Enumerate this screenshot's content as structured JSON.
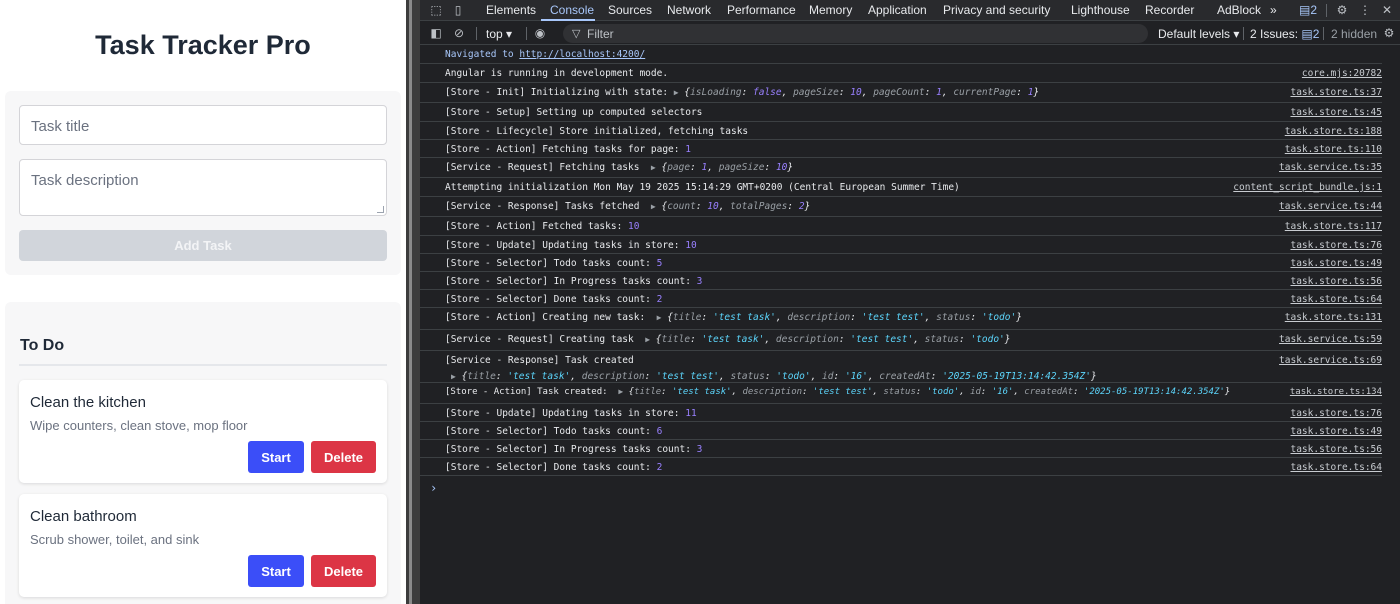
{
  "app": {
    "title": "Task Tracker Pro",
    "form": {
      "title_placeholder": "Task title",
      "description_placeholder": "Task description",
      "add_button": "Add Task"
    },
    "column": {
      "title": "To Do",
      "tasks": [
        {
          "title": "Clean the kitchen",
          "description": "Wipe counters, clean stove, mop floor",
          "start_label": "Start",
          "delete_label": "Delete"
        },
        {
          "title": "Clean bathroom",
          "description": "Scrub shower, toilet, and sink",
          "start_label": "Start",
          "delete_label": "Delete"
        }
      ]
    }
  },
  "devtools": {
    "tabs": [
      "Elements",
      "Console",
      "Sources",
      "Network",
      "Performance",
      "Memory",
      "Application",
      "Privacy and security",
      "Lighthouse",
      "Recorder",
      "AdBlock"
    ],
    "active_tab": "Console",
    "more_tabs": "»",
    "issues_badge": "2",
    "toolbar": {
      "context": "top ▾",
      "filter_placeholder": "Filter",
      "levels": "Default levels ▾",
      "issues_label": "2 Issues:",
      "issues_count": "2",
      "hidden": "2 hidden"
    },
    "console": {
      "navigated_text": "Navigated to ",
      "navigated_url": "http://localhost:4200/",
      "angular_text": "Angular is running in development mode.",
      "angular_src": "core.mjs:20782",
      "init_prefix": "[Store - Init] Initializing with state: ",
      "init_src": "task.store.ts:37",
      "setup_text": "[Store - Setup] Setting up computed selectors",
      "setup_src": "task.store.ts:45",
      "lifecycle_text": "[Store - Lifecycle] Store initialized, fetching tasks",
      "lifecycle_src": "task.store.ts:188",
      "fetching_prefix": "[Store - Action] Fetching tasks for page: ",
      "fetching_page": "1",
      "fetching_src": "task.store.ts:110",
      "svc_req_prefix": "[Service - Request] Fetching tasks  ",
      "svc_req_src": "task.service.ts:35",
      "attempt_text": "Attempting initialization Mon May 19 2025 15:14:29 GMT+0200 (Central European Summer Time)",
      "attempt_src": "content_script_bundle.js:1",
      "svc_resp_prefix": "[Service - Response] Tasks fetched  ",
      "svc_resp_src": "task.service.ts:44",
      "fetched_prefix": "[Store - Action] Fetched tasks: ",
      "fetched_count": "10",
      "fetched_src": "task.store.ts:117",
      "update1_prefix": "[Store - Update] Updating tasks in store: ",
      "update1_count": "10",
      "update1_src": "task.store.ts:76",
      "todo1_prefix": "[Store - Selector] Todo tasks count: ",
      "todo1_count": "5",
      "todo1_src": "task.store.ts:49",
      "inprog1_prefix": "[Store - Selector] In Progress tasks count: ",
      "inprog1_count": "3",
      "inprog1_src": "task.store.ts:56",
      "done1_prefix": "[Store - Selector] Done tasks count: ",
      "done1_count": "2",
      "done1_src": "task.store.ts:64",
      "create_action_prefix": "[Store - Action] Creating new task:  ",
      "create_action_src": "task.store.ts:131",
      "create_req_prefix": "[Service - Request] Creating task  ",
      "create_req_src": "task.service.ts:59",
      "created_resp_text": "[Service - Response] Task created",
      "created_resp_src": "task.service.ts:69",
      "task_created_prefix": "[Store - Action] Task created:  ",
      "task_created_src": "task.store.ts:134",
      "update2_prefix": "[Store - Update] Updating tasks in store: ",
      "update2_count": "11",
      "update2_src": "task.store.ts:76",
      "todo2_prefix": "[Store - Selector] Todo tasks count: ",
      "todo2_count": "6",
      "todo2_src": "task.store.ts:49",
      "inprog2_prefix": "[Store - Selector] In Progress tasks count: ",
      "inprog2_count": "3",
      "inprog2_src": "task.store.ts:56",
      "done2_prefix": "[Store - Selector] Done tasks count: ",
      "done2_count": "2",
      "done2_src": "task.store.ts:64",
      "prompt": "›"
    },
    "objects": {
      "init_obj": {
        "isLoading": "false",
        "pageSize": "10",
        "pageCount": "1",
        "currentPage": "1"
      },
      "svc_req_obj": {
        "page": "1",
        "pageSize": "10"
      },
      "svc_resp_obj": {
        "count": "10",
        "totalPages": "2"
      },
      "new_task": {
        "title": "'test task'",
        "description": "'test test'",
        "status": "'todo'"
      },
      "created_task": {
        "title": "'test task'",
        "description": "'test test'",
        "status": "'todo'",
        "id": "'16'",
        "createdAt": "'2025-05-19T13:14:42.354Z'"
      }
    }
  }
}
